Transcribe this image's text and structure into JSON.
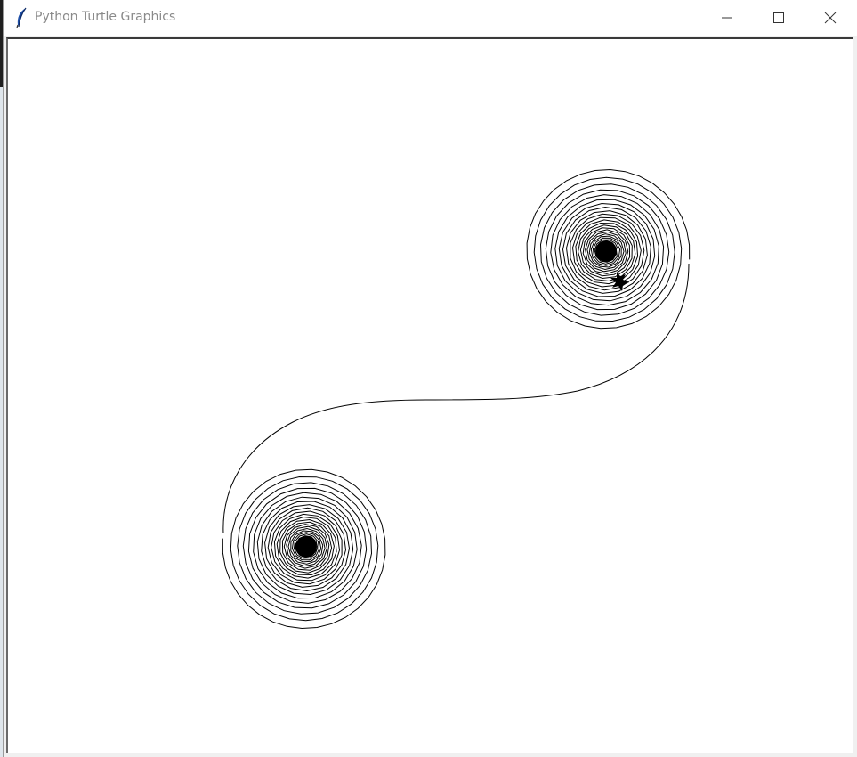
{
  "window": {
    "title": "Python Turtle Graphics",
    "icon": "feather-icon",
    "controls": {
      "minimize_icon": "minimize-icon",
      "maximize_icon": "maximize-icon",
      "close_icon": "close-icon"
    }
  },
  "canvas": {
    "background": "#ffffff",
    "pen_color": "#000000",
    "drawing": "double spiral"
  }
}
